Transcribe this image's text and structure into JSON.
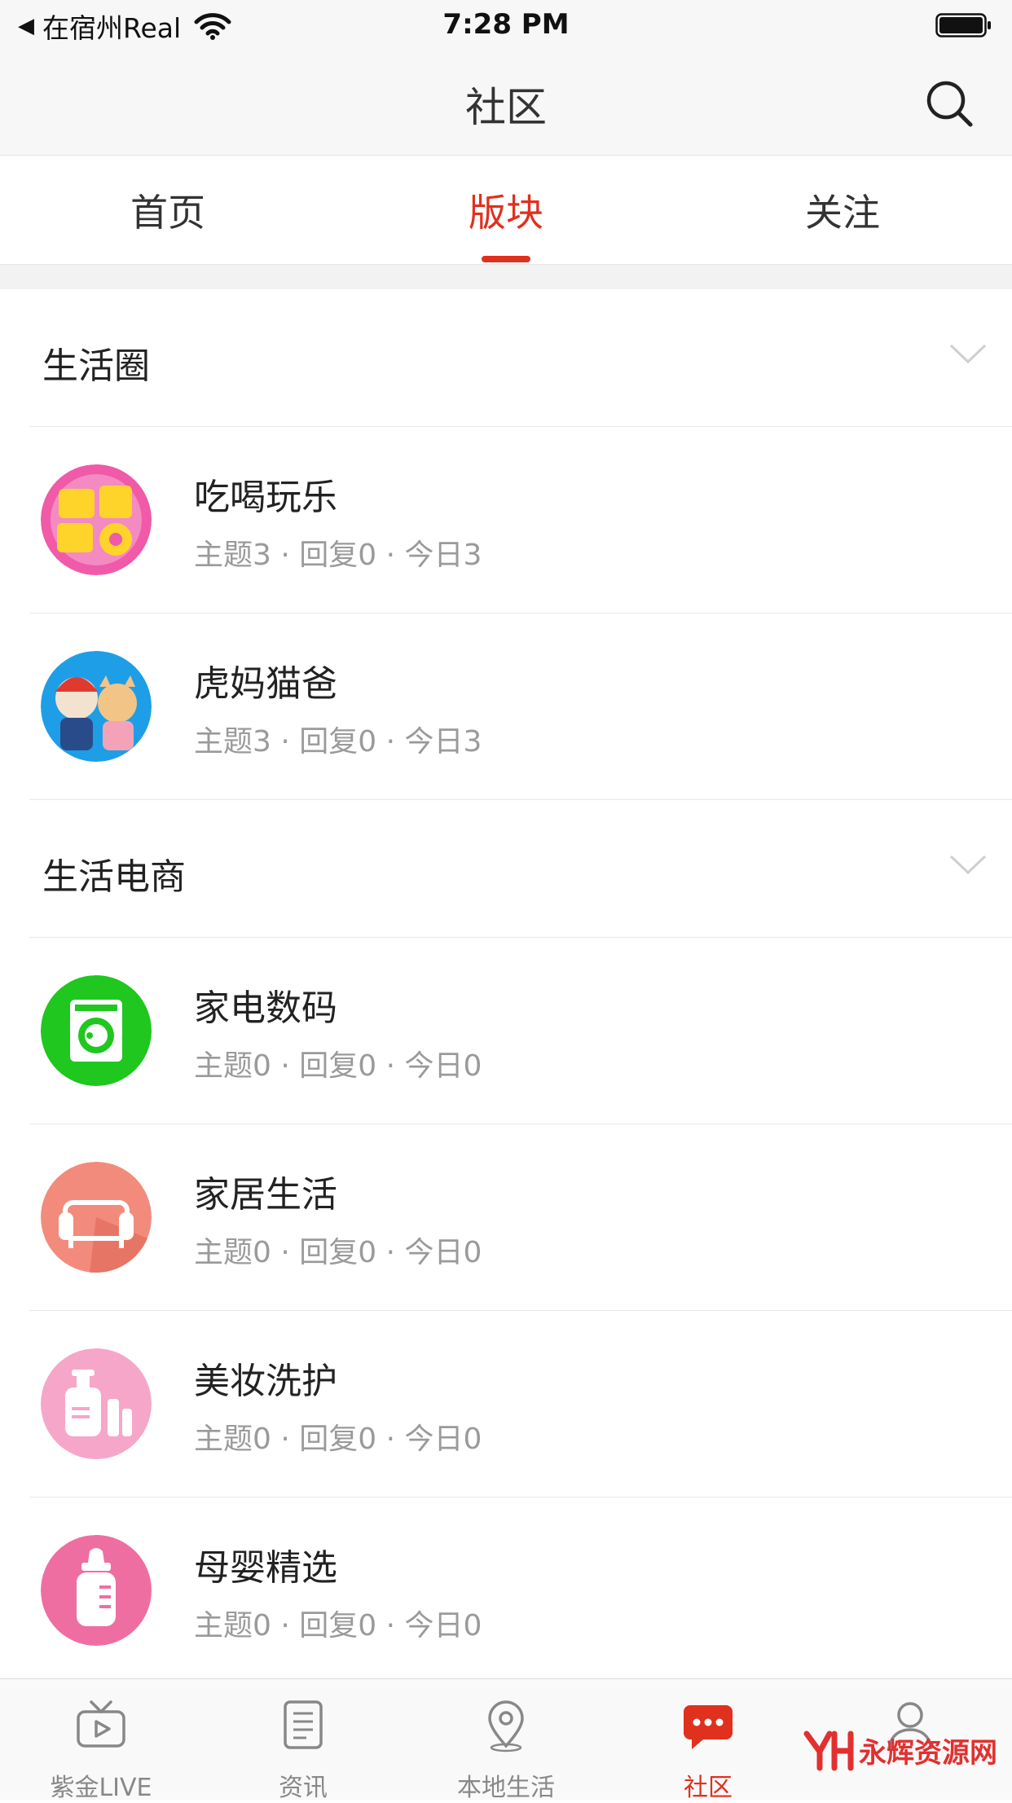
{
  "status_bar": {
    "back_label": "◀",
    "carrier": "在宿州Real",
    "time": "7:28 PM"
  },
  "nav": {
    "title": "社区"
  },
  "tabs": [
    {
      "label": "首页",
      "active": false
    },
    {
      "label": "版块",
      "active": true
    },
    {
      "label": "关注",
      "active": false
    }
  ],
  "groups": [
    {
      "title": "生活圈",
      "items": [
        {
          "name": "吃喝玩乐",
          "stats": "主题3 · 回复0 · 今日3",
          "icon": "food-fun-icon"
        },
        {
          "name": "虎妈猫爸",
          "stats": "主题3 · 回复0 · 今日3",
          "icon": "parents-icon"
        }
      ]
    },
    {
      "title": "生活电商",
      "items": [
        {
          "name": "家电数码",
          "stats": "主题0 · 回复0 · 今日0",
          "icon": "washing-machine-icon"
        },
        {
          "name": "家居生活",
          "stats": "主题0 · 回复0 · 今日0",
          "icon": "sofa-icon"
        },
        {
          "name": "美妆洗护",
          "stats": "主题0 · 回复0 · 今日0",
          "icon": "cosmetics-icon"
        },
        {
          "name": "母婴精选",
          "stats": "主题0 · 回复0 · 今日0",
          "icon": "baby-bottle-icon"
        }
      ]
    }
  ],
  "tabbar": [
    {
      "label": "紫金LIVE",
      "icon": "tv-icon",
      "active": false
    },
    {
      "label": "资讯",
      "icon": "news-icon",
      "active": false
    },
    {
      "label": "本地生活",
      "icon": "location-icon",
      "active": false
    },
    {
      "label": "社区",
      "icon": "chat-icon",
      "active": true
    },
    {
      "label": "",
      "icon": "user-icon",
      "active": false
    }
  ],
  "watermark": {
    "text": "永辉资源网"
  },
  "colors": {
    "accent": "#e0301e",
    "muted_text": "#9a9a9a"
  }
}
